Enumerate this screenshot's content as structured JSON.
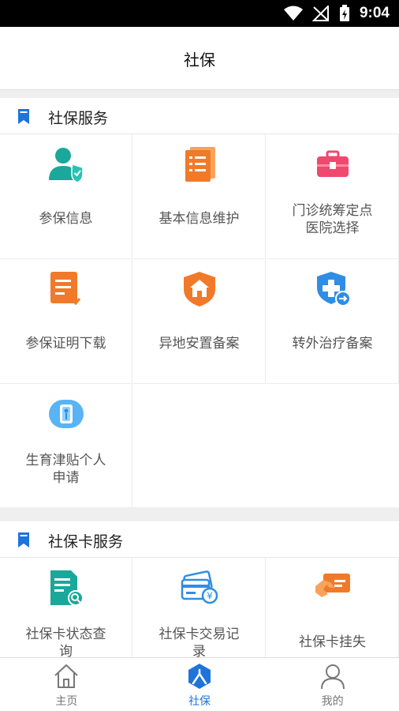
{
  "status_bar": {
    "time": "9:04"
  },
  "title": "社保",
  "social_security_service": {
    "title": "社保服务",
    "items": [
      {
        "label": "参保信息",
        "icon": "insured-person-icon"
      },
      {
        "label": "基本信息维护",
        "icon": "document-list-icon"
      },
      {
        "label": "门诊统筹定点\n医院选择",
        "icon": "medical-kit-icon"
      },
      {
        "label": "参保证明下载",
        "icon": "document-download-icon"
      },
      {
        "label": "异地安置备案",
        "icon": "shield-home-icon"
      },
      {
        "label": "转外治疗备案",
        "icon": "shield-medical-transfer-icon"
      },
      {
        "label": "生育津贴个人\n申请",
        "icon": "maternity-allowance-icon"
      }
    ]
  },
  "social_security_card_service": {
    "title": "社保卡服务",
    "items": [
      {
        "label": "社保卡状态查\n询",
        "icon": "card-status-search-icon"
      },
      {
        "label": "社保卡交易记\n录",
        "icon": "card-transaction-icon"
      },
      {
        "label": "社保卡挂失",
        "icon": "card-report-loss-icon"
      }
    ]
  },
  "tabbar": {
    "items": [
      {
        "label": "主页",
        "icon": "home-icon",
        "active": false
      },
      {
        "label": "社保",
        "icon": "social-security-icon",
        "active": true
      },
      {
        "label": "我的",
        "icon": "profile-icon",
        "active": false
      }
    ]
  },
  "colors": {
    "accent": "#1e74d9",
    "orange": "#f07a2a",
    "teal": "#1aa89a",
    "pink": "#f0486e",
    "blue": "#2f8de4"
  }
}
